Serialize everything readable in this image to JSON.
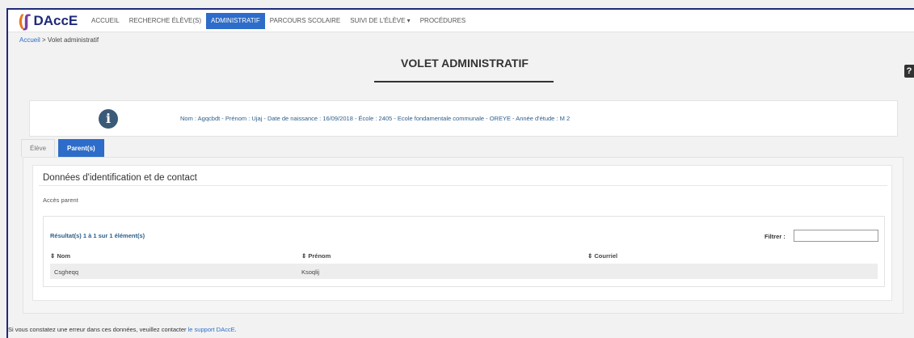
{
  "brand": {
    "name": "DAccE"
  },
  "nav": {
    "items": [
      {
        "label": "ACCUEIL"
      },
      {
        "label": "RECHERCHE ÉLÈVE(S)"
      },
      {
        "label": "ADMINISTRATIF"
      },
      {
        "label": "PARCOURS SCOLAIRE"
      },
      {
        "label": "SUIVI DE L'ÉLÈVE ▾"
      },
      {
        "label": "PROCÉDURES"
      }
    ],
    "active": "ADMINISTRATIF"
  },
  "breadcrumb": {
    "home": "Accueil",
    "separator": " > ",
    "current": "Volet administratif"
  },
  "page": {
    "title": "VOLET ADMINISTRATIF",
    "help_icon": "?"
  },
  "student_info": {
    "icon": "i",
    "text": "Nom : Agqcbdt - Prénom : Ujaj - Date de naissance : 16/09/2018 - École : 2405 - Ecole fondamentale communale - OREYE - Année d'étude : M 2"
  },
  "tabs": [
    {
      "label": "Élève"
    },
    {
      "label": "Parent(s)"
    }
  ],
  "section": {
    "title": "Données d'identification et de contact",
    "acces_label": "Accès parent"
  },
  "table": {
    "results": "Résultat(s) 1 à 1 sur 1 élément(s)",
    "filter_label": "Filtrer :",
    "filter_value": "",
    "columns": [
      "⇕ Nom",
      "⇕ Prénom",
      "⇕ Courriel"
    ],
    "rows": [
      {
        "nom": "Csgheqq",
        "prenom": "Ksoqlij",
        "courriel": ""
      }
    ]
  },
  "footer": {
    "text": "Si vous constatez une erreur dans ces données, veuillez contacter ",
    "link": "le support DAccE",
    "end": "."
  },
  "colors": {
    "primary": "#2d6cc9",
    "brand_dark": "#1f2a7a",
    "info_text": "#2d5f8a"
  }
}
